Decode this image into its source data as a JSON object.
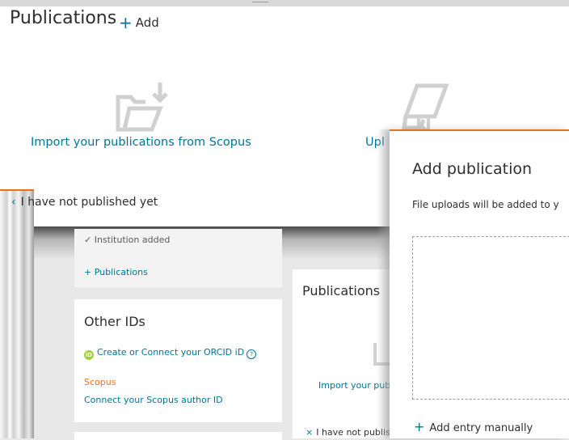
{
  "publications_panel": {
    "title": "Publications",
    "add_label": "Add",
    "import_scopus": "Import your publications from Scopus",
    "upload_partial": "Upl",
    "not_published": "I have not published yet"
  },
  "profile": {
    "institution_added": "✓ Institution added",
    "publications_link": "+ Publications",
    "other_ids": {
      "title": "Other IDs",
      "orcid_link": "Create or Connect your ORCID iD",
      "orcid_badge": "iD",
      "scopus_label": "Scopus",
      "scopus_link": "Connect your Scopus author ID"
    }
  },
  "mid_card": {
    "title": "Publications",
    "import_partial": "Import your pub",
    "not_published_partial": "I have not publis"
  },
  "modal": {
    "title": "Add publication",
    "note_partial": "File uploads will be added to y",
    "manual_entry": "Add entry manually"
  },
  "colors": {
    "accent": "#007398",
    "orange": "#e9711c",
    "orcid_green": "#a6ce39"
  }
}
